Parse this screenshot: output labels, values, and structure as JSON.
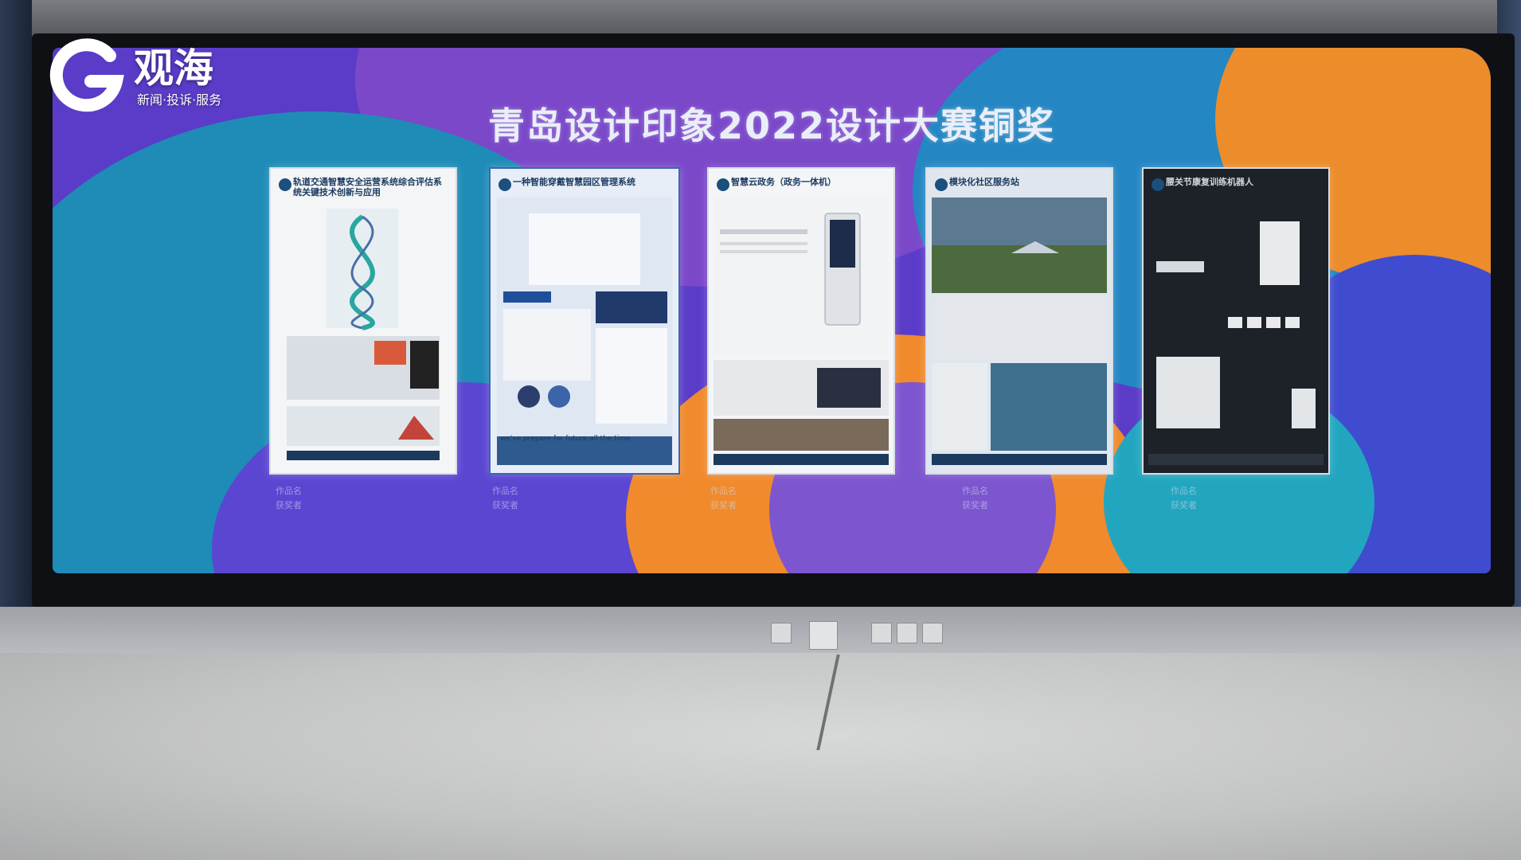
{
  "logo": {
    "name": "观海",
    "tagline": "新闻·投诉·服务"
  },
  "screen": {
    "title": "青岛设计印象2022设计大赛铜奖"
  },
  "posters": [
    {
      "title": "轨道交通智慧安全运营系统综合评估系统关键技术创新与应用"
    },
    {
      "title": "一种智能穿戴智慧园区管理系统",
      "slogan": "we've prepare for future all the time"
    },
    {
      "title": "智慧云政务（政务一体机）"
    },
    {
      "title": "模块化社区服务站"
    },
    {
      "title": "腰关节康复训练机器人"
    }
  ],
  "captions": [
    {
      "work_label": "作品名",
      "winner_label": "获奖者"
    },
    {
      "work_label": "作品名",
      "winner_label": "获奖者"
    },
    {
      "work_label": "作品名",
      "winner_label": "获奖者"
    },
    {
      "work_label": "作品名",
      "winner_label": "获奖者"
    },
    {
      "work_label": "作品名",
      "winner_label": "获奖者"
    }
  ],
  "colors": {
    "screen_purple": "#5a3cc8",
    "screen_blue": "#1e8cb6",
    "screen_orange": "#ec8c2a"
  }
}
